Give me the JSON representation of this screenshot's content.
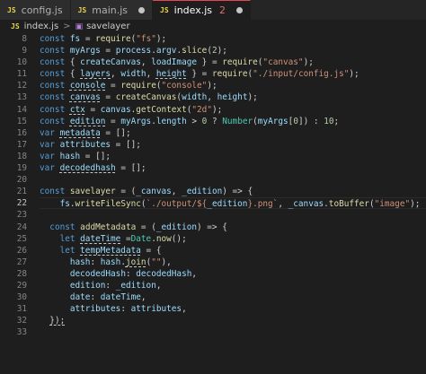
{
  "tabs": [
    {
      "icon": "JS",
      "label": "config.js"
    },
    {
      "icon": "JS",
      "label": "main.js",
      "modified": true
    },
    {
      "icon": "JS",
      "label": "index.js",
      "problems": "2",
      "modified": true
    }
  ],
  "breadcrumb": {
    "file_icon": "JS",
    "file": "index.js",
    "separator": ">",
    "symbol": "savelayer"
  },
  "lines": [
    {
      "n": "8",
      "tokens": [
        [
          "k",
          "const "
        ],
        [
          "v",
          "fs"
        ],
        [
          "p",
          " = "
        ],
        [
          "f",
          "require"
        ],
        [
          "p",
          "("
        ],
        [
          "s",
          "\"fs\""
        ],
        [
          "p",
          ");"
        ]
      ]
    },
    {
      "n": "9",
      "tokens": [
        [
          "k",
          "const "
        ],
        [
          "v",
          "myArgs"
        ],
        [
          "p",
          " = "
        ],
        [
          "v",
          "process"
        ],
        [
          "p",
          "."
        ],
        [
          "v",
          "argv"
        ],
        [
          "p",
          "."
        ],
        [
          "f",
          "slice"
        ],
        [
          "p",
          "("
        ],
        [
          "n",
          "2"
        ],
        [
          "p",
          ");"
        ]
      ]
    },
    {
      "n": "10",
      "tokens": [
        [
          "k",
          "const "
        ],
        [
          "p",
          "{ "
        ],
        [
          "v",
          "createCanvas"
        ],
        [
          "p",
          ", "
        ],
        [
          "v",
          "loadImage"
        ],
        [
          "p",
          " } = "
        ],
        [
          "f",
          "require"
        ],
        [
          "p",
          "("
        ],
        [
          "s",
          "\"canvas\""
        ],
        [
          "p",
          ");"
        ]
      ]
    },
    {
      "n": "11",
      "tokens": [
        [
          "k",
          "const "
        ],
        [
          "p",
          "{ "
        ],
        [
          "v",
          "layers",
          "sq"
        ],
        [
          "p",
          ", "
        ],
        [
          "v",
          "width"
        ],
        [
          "p",
          ", "
        ],
        [
          "v",
          "height",
          "sq"
        ],
        [
          "p",
          " } = "
        ],
        [
          "f",
          "require"
        ],
        [
          "p",
          "("
        ],
        [
          "s",
          "\"./input/config.js\""
        ],
        [
          "p",
          ");"
        ]
      ]
    },
    {
      "n": "12",
      "tokens": [
        [
          "k",
          "const "
        ],
        [
          "v",
          "console",
          "sq"
        ],
        [
          "p",
          " = "
        ],
        [
          "f",
          "require"
        ],
        [
          "p",
          "("
        ],
        [
          "s",
          "\"console\""
        ],
        [
          "p",
          ");"
        ]
      ]
    },
    {
      "n": "13",
      "tokens": [
        [
          "k",
          "const "
        ],
        [
          "v",
          "canvas",
          "sq"
        ],
        [
          "p",
          " = "
        ],
        [
          "f",
          "createCanvas"
        ],
        [
          "p",
          "("
        ],
        [
          "v",
          "width"
        ],
        [
          "p",
          ", "
        ],
        [
          "v",
          "height"
        ],
        [
          "p",
          ");"
        ]
      ]
    },
    {
      "n": "14",
      "tokens": [
        [
          "k",
          "const "
        ],
        [
          "v",
          "ctx",
          "sq"
        ],
        [
          "p",
          " = "
        ],
        [
          "v",
          "canvas"
        ],
        [
          "p",
          "."
        ],
        [
          "f",
          "getContext"
        ],
        [
          "p",
          "("
        ],
        [
          "s",
          "\"2d\""
        ],
        [
          "p",
          ");"
        ]
      ]
    },
    {
      "n": "15",
      "tokens": [
        [
          "k",
          "const "
        ],
        [
          "v",
          "edition",
          "sq"
        ],
        [
          "p",
          " = "
        ],
        [
          "v",
          "myArgs"
        ],
        [
          "p",
          "."
        ],
        [
          "v",
          "length"
        ],
        [
          "p",
          " > "
        ],
        [
          "n",
          "0"
        ],
        [
          "p",
          " ? "
        ],
        [
          "t",
          "Number"
        ],
        [
          "p",
          "("
        ],
        [
          "v",
          "myArgs"
        ],
        [
          "p",
          "["
        ],
        [
          "n",
          "0"
        ],
        [
          "p",
          "]) : "
        ],
        [
          "n",
          "10"
        ],
        [
          "p",
          ";"
        ]
      ]
    },
    {
      "n": "16",
      "tokens": [
        [
          "k",
          "var "
        ],
        [
          "v",
          "metadata",
          "sq"
        ],
        [
          "p",
          " = [];"
        ]
      ]
    },
    {
      "n": "17",
      "tokens": [
        [
          "k",
          "var "
        ],
        [
          "v",
          "attributes"
        ],
        [
          "p",
          " = [];"
        ]
      ]
    },
    {
      "n": "18",
      "tokens": [
        [
          "k",
          "var "
        ],
        [
          "v",
          "hash"
        ],
        [
          "p",
          " = [];"
        ]
      ]
    },
    {
      "n": "19",
      "tokens": [
        [
          "k",
          "var "
        ],
        [
          "v",
          "decodedhash",
          "sq"
        ],
        [
          "p",
          " = [];"
        ]
      ]
    },
    {
      "n": "20",
      "tokens": []
    },
    {
      "n": "21",
      "tokens": [
        [
          "k",
          "const "
        ],
        [
          "f",
          "savelayer"
        ],
        [
          "p",
          " = ("
        ],
        [
          "v",
          "_canvas"
        ],
        [
          "p",
          ", "
        ],
        [
          "v",
          "_edition"
        ],
        [
          "p",
          ") => {"
        ]
      ]
    },
    {
      "n": "22",
      "tokens": [
        [
          "p",
          "    "
        ],
        [
          "v",
          "fs"
        ],
        [
          "p",
          "."
        ],
        [
          "f",
          "writeFileSync"
        ],
        [
          "p",
          "("
        ],
        [
          "s",
          "`./output/${"
        ],
        [
          "v",
          "_edition"
        ],
        [
          "s",
          "}.png`"
        ],
        [
          "p",
          ", "
        ],
        [
          "v",
          "_canvas"
        ],
        [
          "p",
          "."
        ],
        [
          "f",
          "toBuffer"
        ],
        [
          "p",
          "("
        ],
        [
          "s",
          "\"image\""
        ],
        [
          "p",
          ");"
        ]
      ],
      "current": true
    },
    {
      "n": "23",
      "tokens": []
    },
    {
      "n": "24",
      "tokens": [
        [
          "p",
          "  "
        ],
        [
          "k",
          "const "
        ],
        [
          "f",
          "addMetadata"
        ],
        [
          "p",
          " = ("
        ],
        [
          "v",
          "_edition"
        ],
        [
          "p",
          ") => {"
        ]
      ]
    },
    {
      "n": "25",
      "tokens": [
        [
          "p",
          "    "
        ],
        [
          "k",
          "let "
        ],
        [
          "v",
          "dateTime",
          "sq"
        ],
        [
          "p",
          " ="
        ],
        [
          "t",
          "Date"
        ],
        [
          "p",
          "."
        ],
        [
          "f",
          "now"
        ],
        [
          "p",
          "();"
        ]
      ]
    },
    {
      "n": "26",
      "tokens": [
        [
          "p",
          "    "
        ],
        [
          "k",
          "let "
        ],
        [
          "v",
          "tempMetadata",
          "sq"
        ],
        [
          "p",
          " = {"
        ]
      ]
    },
    {
      "n": "27",
      "tokens": [
        [
          "p",
          "      "
        ],
        [
          "v",
          "hash"
        ],
        [
          "p",
          ": "
        ],
        [
          "v",
          "hash"
        ],
        [
          "p",
          "."
        ],
        [
          "f",
          "join",
          "sq"
        ],
        [
          "p",
          "("
        ],
        [
          "s",
          "\"\""
        ],
        [
          "p",
          "),"
        ]
      ]
    },
    {
      "n": "28",
      "tokens": [
        [
          "p",
          "      "
        ],
        [
          "v",
          "decodedHash"
        ],
        [
          "p",
          ": "
        ],
        [
          "v",
          "decodedHash"
        ],
        [
          "p",
          ","
        ]
      ]
    },
    {
      "n": "29",
      "tokens": [
        [
          "p",
          "      "
        ],
        [
          "v",
          "edition"
        ],
        [
          "p",
          ": "
        ],
        [
          "v",
          "_edition"
        ],
        [
          "p",
          ","
        ]
      ]
    },
    {
      "n": "30",
      "tokens": [
        [
          "p",
          "      "
        ],
        [
          "v",
          "date"
        ],
        [
          "p",
          ": "
        ],
        [
          "v",
          "dateTime"
        ],
        [
          "p",
          ","
        ]
      ]
    },
    {
      "n": "31",
      "tokens": [
        [
          "p",
          "      "
        ],
        [
          "v",
          "attributes"
        ],
        [
          "p",
          ": "
        ],
        [
          "v",
          "attributes"
        ],
        [
          "p",
          ","
        ]
      ]
    },
    {
      "n": "32",
      "tokens": [
        [
          "p",
          "  "
        ],
        [
          "p",
          "});",
          "sq"
        ]
      ]
    },
    {
      "n": "33",
      "tokens": []
    }
  ],
  "colors": {
    "keyword": "#569cd6",
    "variable": "#9cdcfe",
    "string": "#ce9178",
    "function": "#dcdcaa",
    "number": "#b5cea8",
    "type": "#4ec9b0",
    "active_tab_border": "#e64553",
    "js_icon": "#e8d44d"
  }
}
